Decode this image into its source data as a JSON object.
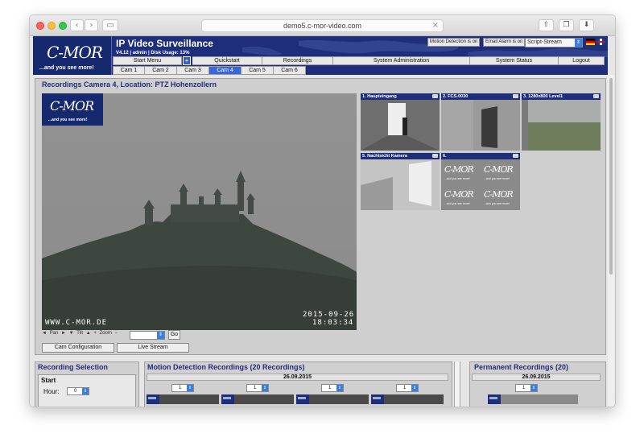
{
  "browser": {
    "url": "demo5.c-mor-video.com",
    "back_icon": "chevron-left-icon",
    "forward_icon": "chevron-right-icon"
  },
  "header": {
    "logo_text": "C-MOR",
    "logo_tagline": "...and you see more!",
    "title": "IP Video Surveillance",
    "version_info": "V4.12 | admin | Disk Usage: 13%",
    "motion_detection": "Motion Detection is on",
    "email_alarm": "Email Alarm is on",
    "stream_mode": "Script-Stream"
  },
  "menu": {
    "items": [
      "Start Menu",
      "Quickstart",
      "Recordings",
      "System Administration",
      "System Status",
      "Logout"
    ],
    "plus_label": "+"
  },
  "cam_tabs": [
    "Cam 1",
    "Cam 2",
    "Cam 3",
    "Cam 4",
    "Cam 5",
    "Cam 6"
  ],
  "active_cam": "Cam 4",
  "panel": {
    "title": "Recordings Camera 4, Location: PTZ Hohenzollern",
    "osd_site": "WWW.C-MOR.DE",
    "osd_date": "2015-09-26",
    "osd_time": "18:03:34",
    "ptz_pan": "Pan",
    "ptz_tilt": "Tilt",
    "ptz_zoom": "Zoom",
    "go_label": "Go",
    "cam_config_label": "Cam Configuration",
    "live_stream_label": "Live Stream"
  },
  "thumbnails": [
    {
      "label": "1. Haupteingang"
    },
    {
      "label": "2. FCS-0030"
    },
    {
      "label": "3. 1280x800 Level1"
    },
    {
      "label": "5. Nachtsicht Kamera"
    },
    {
      "label": "6."
    }
  ],
  "recording_selection": {
    "title": "Recording Selection",
    "start_label": "Start",
    "hour_label": "Hour:",
    "hour_value": "0"
  },
  "motion_recordings": {
    "title": "Motion Detection Recordings (20 Recordings)",
    "date": "26.09.2015",
    "counters": [
      "1",
      "1",
      "1",
      "1"
    ]
  },
  "permanent_recordings": {
    "title": "Permanent Recordings (20)",
    "date": "26.09.2015",
    "counter": "1"
  },
  "colors": {
    "brand_navy": "#1e2e7b",
    "active_tab": "#3a66d8",
    "select_blue": "#3a7fe0"
  }
}
